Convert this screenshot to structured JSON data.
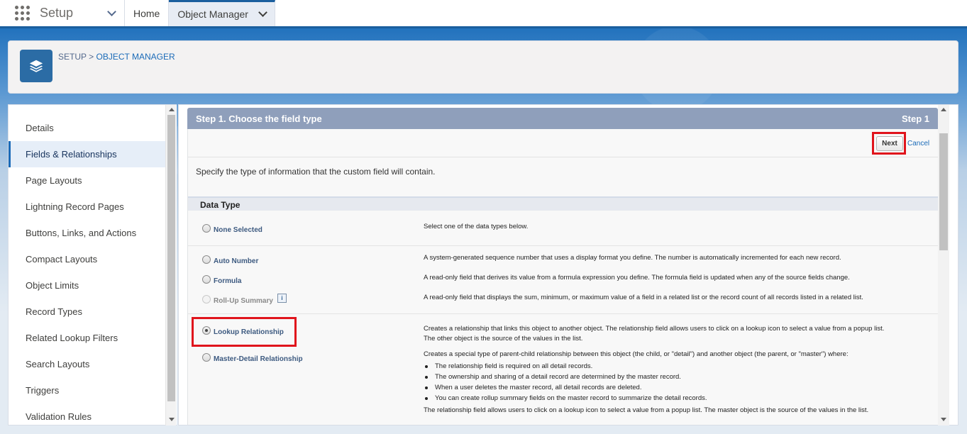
{
  "topbar": {
    "app_name": "Setup",
    "tabs": [
      {
        "label": "Home"
      },
      {
        "label": "Object Manager"
      }
    ]
  },
  "header": {
    "breadcrumb_root": "SETUP",
    "breadcrumb_sep": ">",
    "breadcrumb_current": "OBJECT MANAGER"
  },
  "sidebar": {
    "items": [
      {
        "label": "Details"
      },
      {
        "label": "Fields & Relationships"
      },
      {
        "label": "Page Layouts"
      },
      {
        "label": "Lightning Record Pages"
      },
      {
        "label": "Buttons, Links, and Actions"
      },
      {
        "label": "Compact Layouts"
      },
      {
        "label": "Object Limits"
      },
      {
        "label": "Record Types"
      },
      {
        "label": "Related Lookup Filters"
      },
      {
        "label": "Search Layouts"
      },
      {
        "label": "Triggers"
      },
      {
        "label": "Validation Rules"
      }
    ],
    "active_index": 1
  },
  "step": {
    "title": "Step 1. Choose the field type",
    "step_label": "Step 1",
    "next_label": "Next",
    "cancel_label": "Cancel",
    "intro": "Specify the type of information that the custom field will contain."
  },
  "data_type": {
    "heading": "Data Type",
    "none": {
      "label": "None Selected",
      "desc": "Select one of the data types below."
    },
    "auto_number": {
      "label": "Auto Number",
      "desc": "A system-generated sequence number that uses a display format you define. The number is automatically incremented for each new record."
    },
    "formula": {
      "label": "Formula",
      "desc": "A read-only field that derives its value from a formula expression you define. The formula field is updated when any of the source fields change."
    },
    "rollup": {
      "label": "Roll-Up Summary",
      "info": "i",
      "desc": "A read-only field that displays the sum, minimum, or maximum value of a field in a related list or the record count of all records listed in a related list."
    },
    "lookup": {
      "label": "Lookup Relationship",
      "desc_1": "Creates a relationship that links this object to another object. The relationship field allows users to click on a lookup icon to select a value from a popup list.",
      "desc_2": "The other object is the source of the values in the list."
    },
    "master_detail": {
      "label": "Master-Detail Relationship",
      "desc": "Creates a special type of parent-child relationship between this object (the child, or \"detail\") and another object (the parent, or \"master\") where:",
      "bullets": [
        "The relationship field is required on all detail records.",
        "The ownership and sharing of a detail record are determined by the master record.",
        "When a user deletes the master record, all detail records are deleted.",
        "You can create rollup summary fields on the master record to summarize the detail records."
      ],
      "desc_after": "The relationship field allows users to click on a lookup icon to select a value from a popup list. The master object is the source of the values in the list."
    }
  },
  "colors": {
    "accent": "#1b6bb8",
    "highlight": "#e0141c",
    "step_header": "#8f9fbb"
  },
  "icons": [
    "app-launcher-icon",
    "chevron-down-icon",
    "layers-icon",
    "info-icon"
  ]
}
